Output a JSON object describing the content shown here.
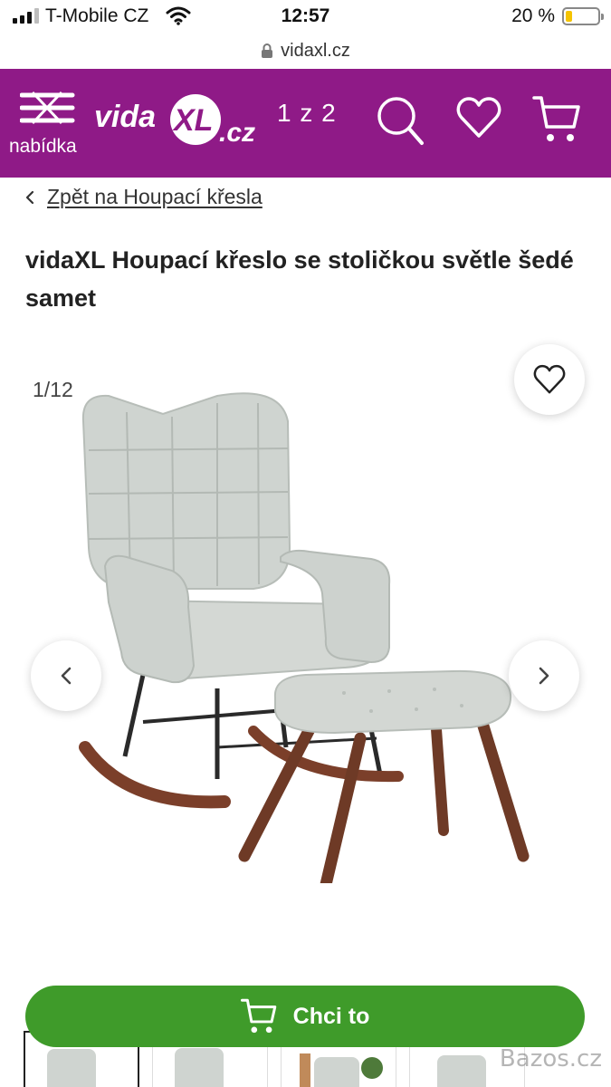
{
  "status_bar": {
    "carrier": "T-Mobile CZ",
    "time": "12:57",
    "battery_pct": "20 %",
    "battery_level": 0.2
  },
  "browser": {
    "url": "vidaxl.cz"
  },
  "header": {
    "menu_label": "nabídka",
    "logo_text": "vidaXL.cz",
    "pager": "1 z 2",
    "brand_color": "#8f1a87"
  },
  "back_link": {
    "label": "Zpět na Houpací křesla"
  },
  "product": {
    "title": "vidaXL Houpací křeslo se stoličkou světle šedé samet",
    "image_counter": "1/12"
  },
  "cta": {
    "label": "Chci to",
    "color": "#3f9b2a"
  },
  "watermark": "Bazos.cz",
  "icons": [
    "menu-icon",
    "search-icon",
    "heart-icon",
    "cart-icon",
    "lock-icon",
    "chevron-left-icon",
    "chevron-right-icon",
    "wifi-icon",
    "battery-icon"
  ]
}
